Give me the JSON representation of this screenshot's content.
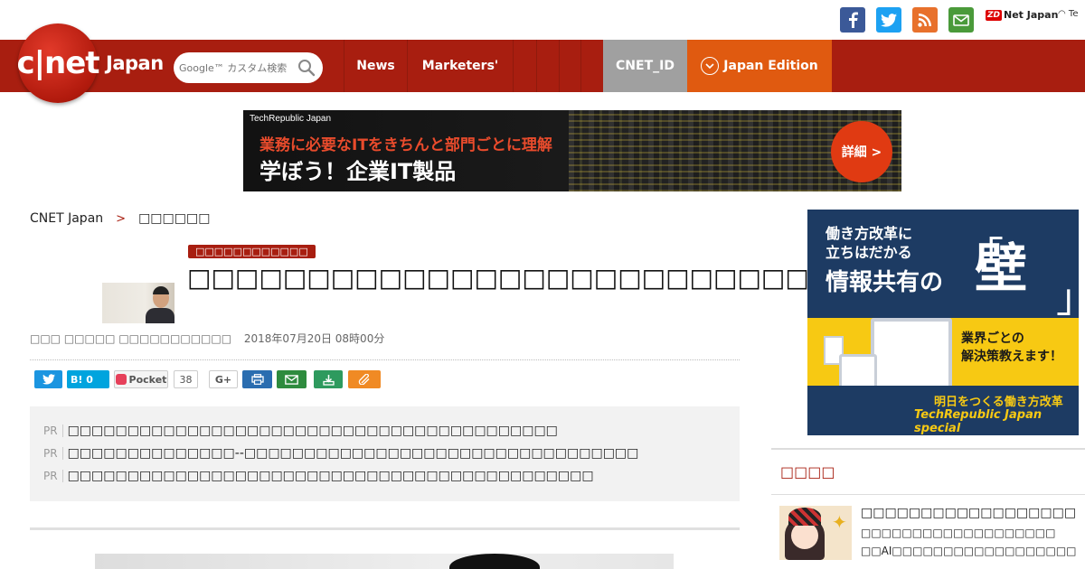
{
  "header": {
    "logo_text": "c|net",
    "logo_region": "Japan",
    "search_placeholder": "Google™ カスタム検索",
    "social": [
      "facebook-icon",
      "twitter-icon",
      "rss-icon",
      "mail-icon"
    ],
    "zdnet_badge": "ZD",
    "zdnet_label": "Net Japan",
    "techrepublic_label": "Te",
    "nav": [
      "News",
      "Marketers'",
      "",
      "",
      ""
    ],
    "cnet_id": "CNET_ID",
    "edition": "Japan Edition",
    "colors": {
      "brand_red": "#a81e10",
      "edition_orange": "#e05a10",
      "id_gray": "#a0a0a0"
    }
  },
  "banner": {
    "source": "TechRepublic Japan",
    "line1": "業務に必要なITをきちんと部門ごとに理解",
    "line2": "学ぼう！企業IT製品",
    "button": "詳細 >"
  },
  "breadcrumb": {
    "root": "CNET Japan",
    "separator": ">",
    "current": "□□□□□□"
  },
  "article": {
    "category": "□□□□□□□□□□□□",
    "title": "□□□□□□□□□□□□□□□□□□□□□□□□□□□□",
    "author": "□□□ □□□□□ □□□□□□□□□□□",
    "date": "2018年07月20日 08時00分"
  },
  "share": {
    "hatena": "B! 0",
    "pocket_label": "Pocket",
    "pocket_count": "38",
    "gplus": "G+"
  },
  "pr_items": [
    {
      "tag": "PR",
      "text": "□□□□□□□□□□□□□□□□□□□□□□□□□□□□□□□□□□□□□□□□□"
    },
    {
      "tag": "PR",
      "text": "□□□□□□□□□□□□□□--□□□□□□□□□□□□□□□□□□□□□□□□□□□□□□□□□"
    },
    {
      "tag": "PR",
      "text": "□□□□□□□□□□□□□□□□□□□□□□□□□□□□□□□□□□□□□□□□□□□□"
    }
  ],
  "sidebar": {
    "ad": {
      "line1": "働き方改革に",
      "line2": "立ちはだかる",
      "line3": "情報共有の",
      "big": "壁",
      "bracket_open": "「",
      "bracket_close": "」",
      "sub1": "業界ごとの",
      "sub2": "解決策教えます！",
      "foot1": "明日をつくる働き方改革",
      "foot2": "TechRepublic Japan special"
    },
    "section_title": "□□□□",
    "related": {
      "title": "□□□□□□□□□□□□□□□□□□",
      "line1": "□□□□□□□□□□□□□□□□□□□",
      "line2": "□□AI□□□□□□□□□□□□□□□□□□"
    }
  }
}
